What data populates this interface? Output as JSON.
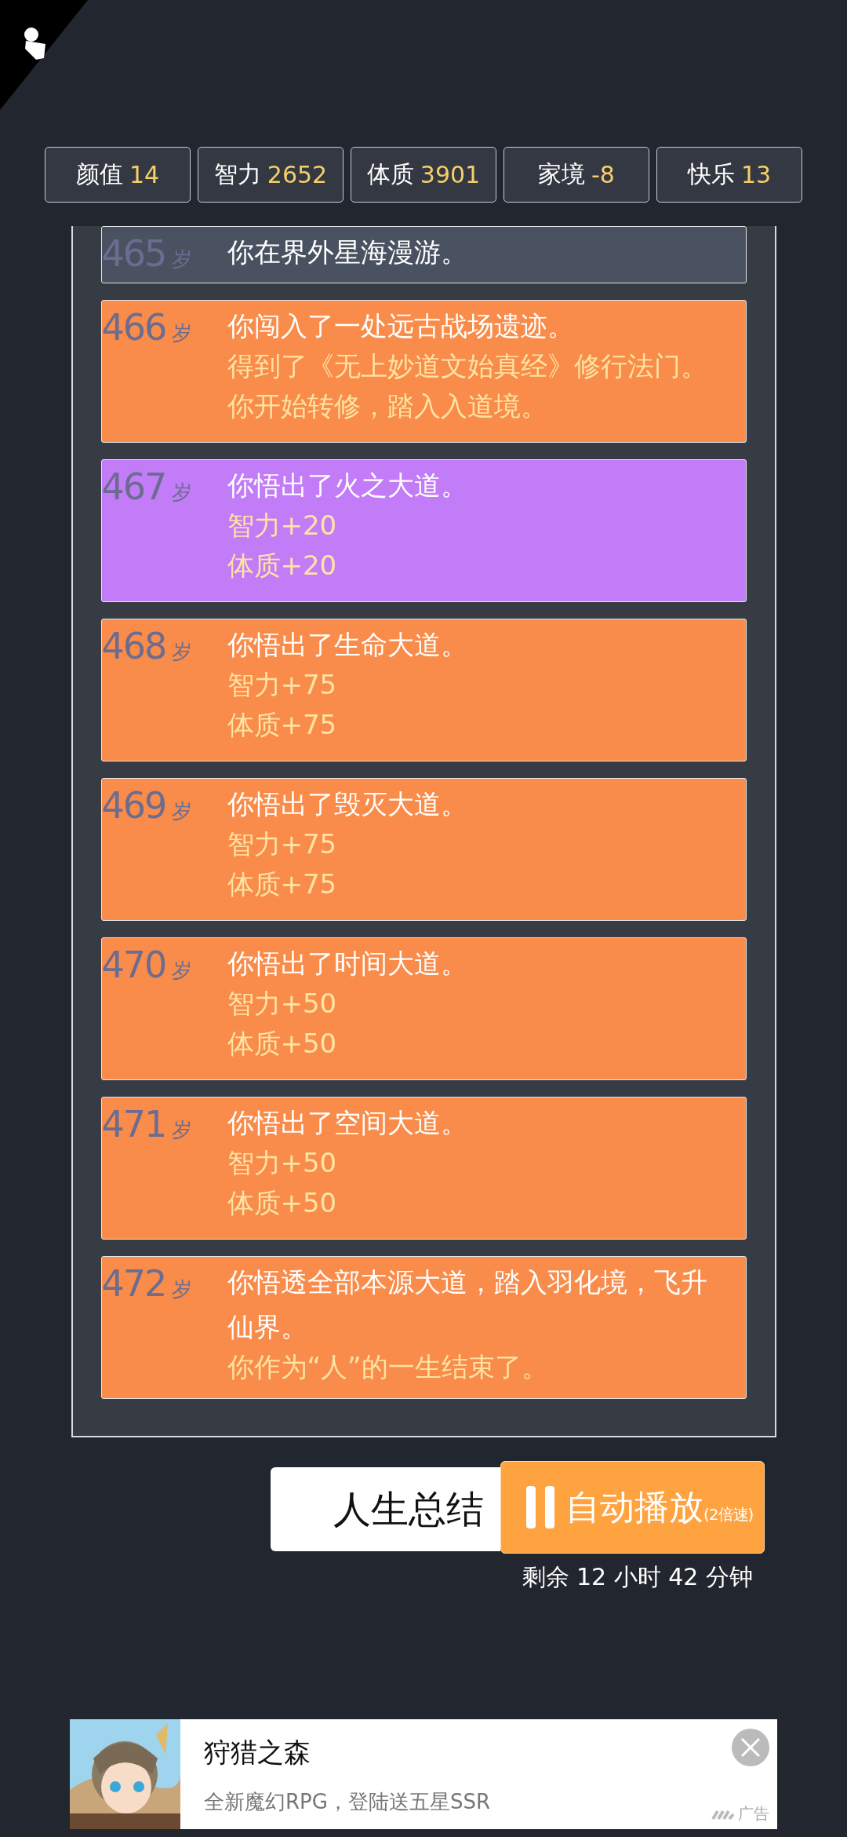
{
  "stats": [
    {
      "label": "颜值",
      "value": "14"
    },
    {
      "label": "智力",
      "value": "2652"
    },
    {
      "label": "体质",
      "value": "3901"
    },
    {
      "label": "家境",
      "value": "-8"
    },
    {
      "label": "快乐",
      "value": "13"
    }
  ],
  "events": [
    {
      "age": "465",
      "unit": "岁",
      "color": "#4a5261",
      "lines": [
        "你在界外星海漫游。"
      ]
    },
    {
      "age": "466",
      "unit": "岁",
      "color": "#f98c4a",
      "lines": [
        "你闯入了一处远古战场遗迹。",
        "得到了《无上妙道文始真经》修行法门。",
        "你开始转修，踏入入道境。"
      ]
    },
    {
      "age": "467",
      "unit": "岁",
      "color": "#c27cf8",
      "lines": [
        "你悟出了火之大道。",
        "智力+20",
        "体质+20"
      ]
    },
    {
      "age": "468",
      "unit": "岁",
      "color": "#f98c4a",
      "lines": [
        "你悟出了生命大道。",
        "智力+75",
        "体质+75"
      ]
    },
    {
      "age": "469",
      "unit": "岁",
      "color": "#f98c4a",
      "lines": [
        "你悟出了毁灭大道。",
        "智力+75",
        "体质+75"
      ]
    },
    {
      "age": "470",
      "unit": "岁",
      "color": "#f98c4a",
      "lines": [
        "你悟出了时间大道。",
        "智力+50",
        "体质+50"
      ]
    },
    {
      "age": "471",
      "unit": "岁",
      "color": "#f98c4a",
      "lines": [
        "你悟出了空间大道。",
        "智力+50",
        "体质+50"
      ]
    },
    {
      "age": "472",
      "unit": "岁",
      "color": "#f98c4a",
      "lines": [
        "你悟透全部本源大道，踏入羽化境，飞升仙界。",
        "你作为“人”的一生结束了。"
      ]
    }
  ],
  "summary_button": "人生总结",
  "autoplay": {
    "label": "自动播放",
    "speed": "(2倍速)",
    "playing": true
  },
  "remaining": "剩余 12 小时 42 分钟",
  "ad": {
    "title": "狩猎之森",
    "subtitle": "全新魔幻RPG，登陆送五星SSR",
    "tag": "广告"
  }
}
